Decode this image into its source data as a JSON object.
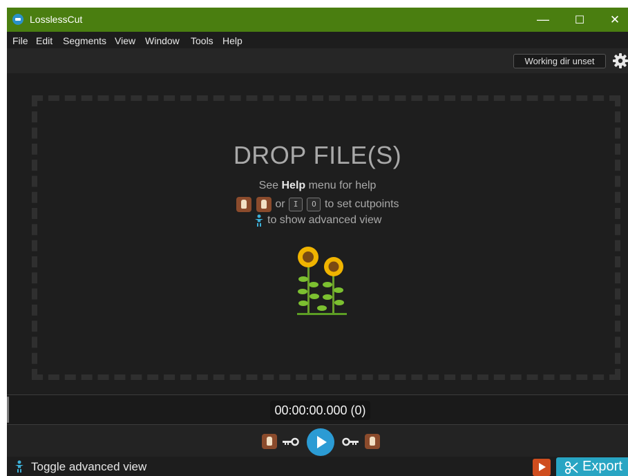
{
  "window": {
    "title": "LosslessCut",
    "controls": {
      "minimize": "—",
      "maximize": "☐",
      "close": "✕"
    }
  },
  "menu": [
    "File",
    "Edit",
    "Segments",
    "View",
    "Window",
    "Tools",
    "Help"
  ],
  "toolbar": {
    "working_dir": "Working dir unset"
  },
  "drop_area": {
    "title": "DROP FILE(S)",
    "help_prefix": "See ",
    "help_bold": "Help",
    "help_suffix": " menu for help",
    "cutpoints_or": "or",
    "key_in": "I",
    "key_out": "O",
    "cutpoints_suffix": "to set cutpoints",
    "advanced_text": "to show advanced view"
  },
  "timeline": {
    "timecode": "00:00:00.000 (0)"
  },
  "bottom": {
    "toggle_label": "Toggle advanced view",
    "export_label": "Export"
  },
  "colors": {
    "titlebar": "#4a7e10",
    "accent_play": "#2b9bd4",
    "export": "#28a5c3",
    "orange": "#cf4d1e"
  },
  "icons": {
    "app": "losslesscut-app-icon",
    "settings": "gear-icon",
    "hand": "hand-cutpoint-icon",
    "key": "key-icon",
    "play": "play-icon",
    "scissors": "scissors-icon",
    "advanced": "person-icon",
    "illustration": "sunflowers-icon"
  }
}
